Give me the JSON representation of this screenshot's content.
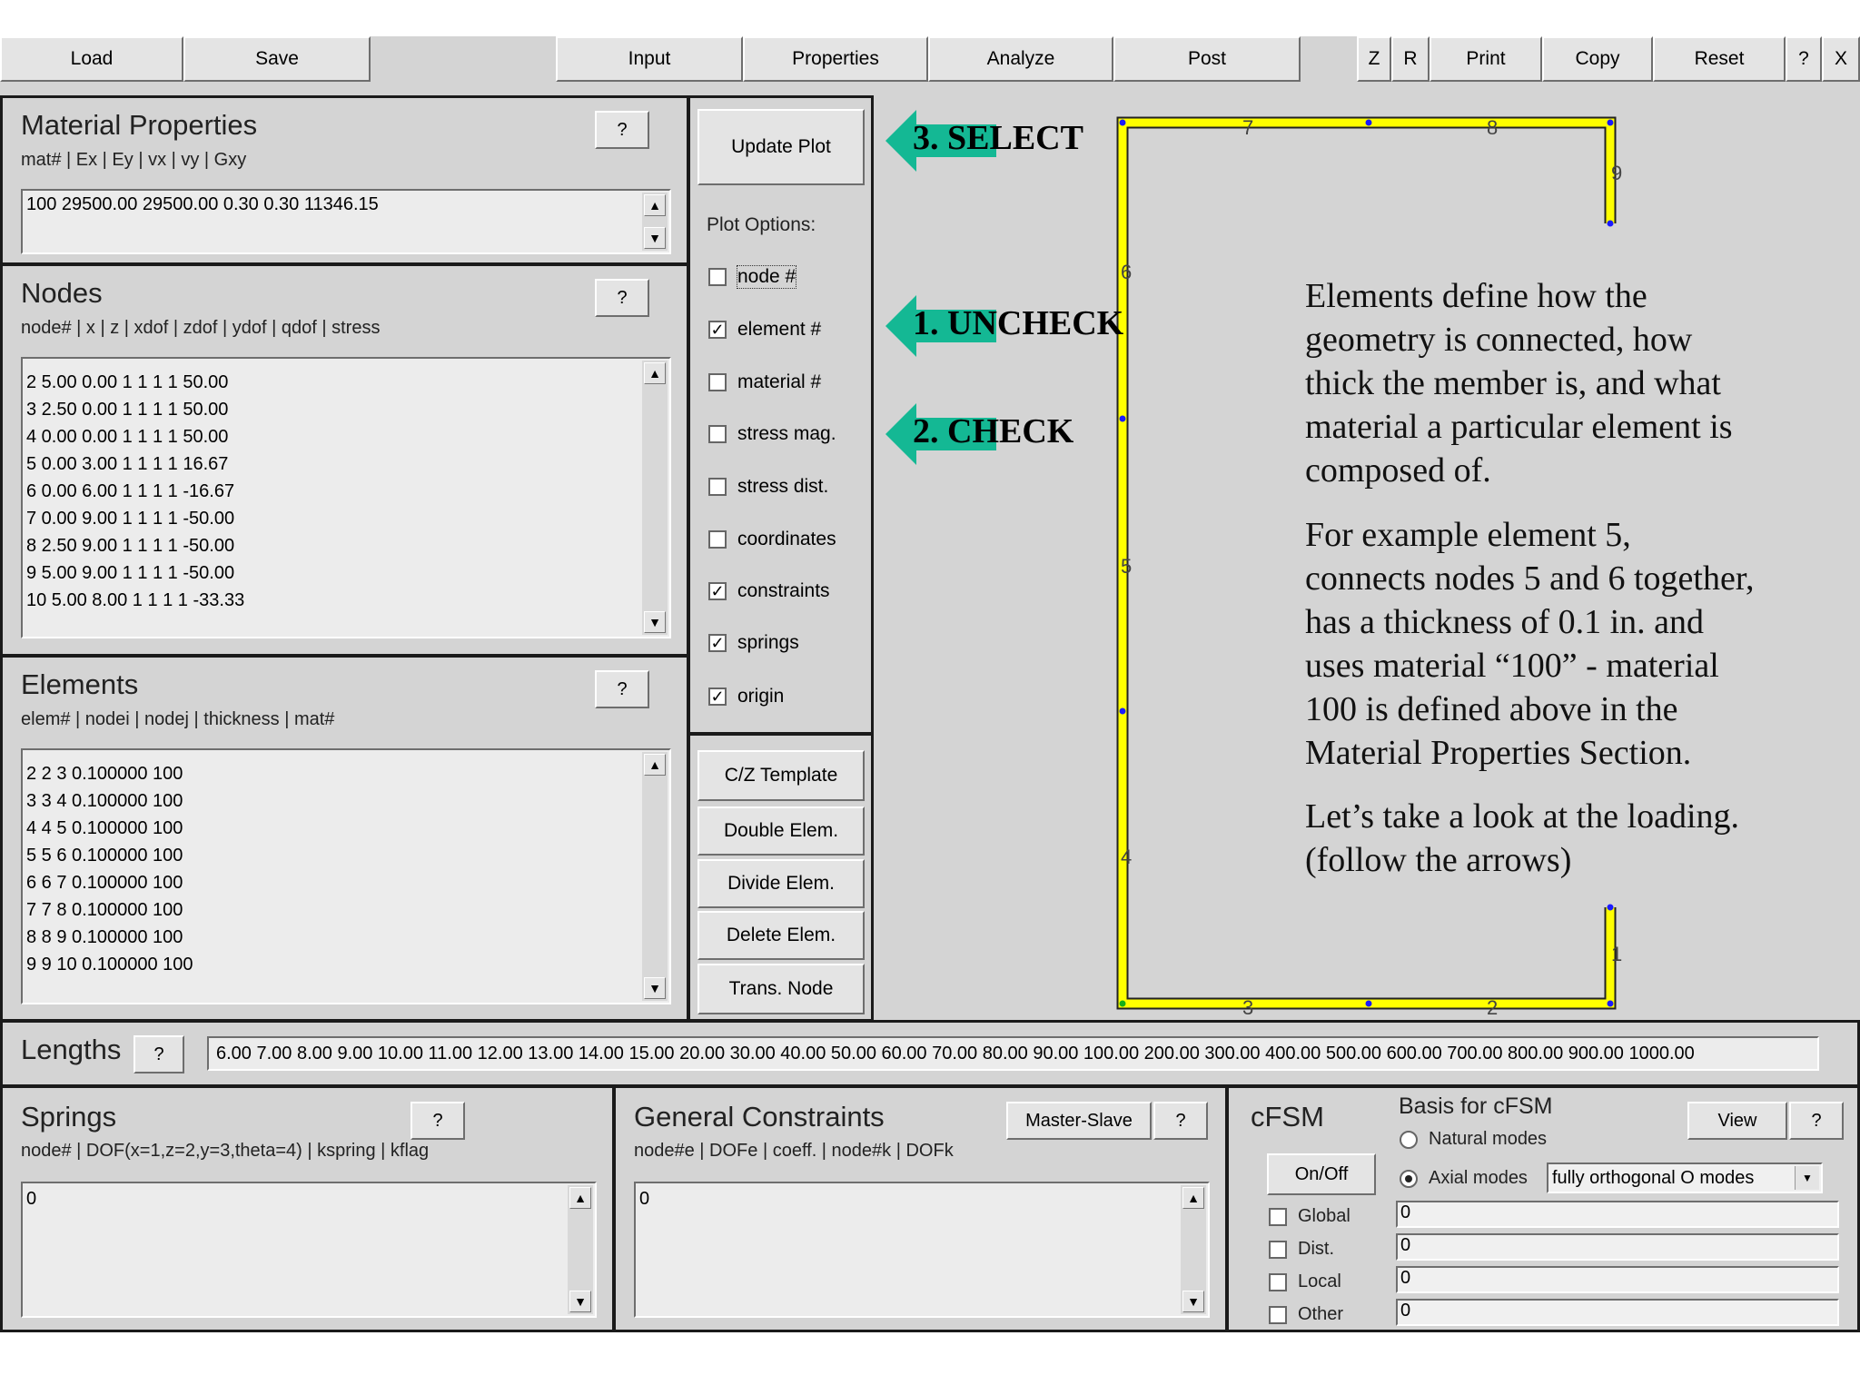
{
  "toolbar": {
    "load": "Load",
    "save": "Save",
    "input": "Input",
    "properties": "Properties",
    "analyze": "Analyze",
    "post": "Post",
    "z": "Z",
    "r": "R",
    "print": "Print",
    "copy": "Copy",
    "reset": "Reset",
    "help": "?",
    "close": "X"
  },
  "material": {
    "title": "Material Properties",
    "header": "mat# | Ex | Ey | vx | vy | Gxy",
    "help": "?",
    "rows": [
      "100 29500.00 29500.00 0.30 0.30 11346.15"
    ]
  },
  "nodes": {
    "title": "Nodes",
    "header": "node# | x | z | xdof | zdof | ydof | qdof | stress",
    "help": "?",
    "rows": [
      "2 5.00 0.00 1 1 1 1 50.00",
      "3 2.50 0.00 1 1 1 1 50.00",
      "4 0.00 0.00 1 1 1 1 50.00",
      "5 0.00 3.00 1 1 1 1 16.67",
      "6 0.00 6.00 1 1 1 1 -16.67",
      "7 0.00 9.00 1 1 1 1 -50.00",
      "8 2.50 9.00 1 1 1 1 -50.00",
      "9 5.00 9.00 1 1 1 1 -50.00",
      "10 5.00 8.00 1 1 1 1 -33.33"
    ]
  },
  "elements": {
    "title": "Elements",
    "header": "elem# | nodei | nodej | thickness | mat#",
    "help": "?",
    "rows": [
      "2 2 3 0.100000 100",
      "3 3 4 0.100000 100",
      "4 4 5 0.100000 100",
      "5 5 6 0.100000 100",
      "6 6 7 0.100000 100",
      "7 7 8 0.100000 100",
      "8 8 9 0.100000 100",
      "9 9 10 0.100000 100"
    ]
  },
  "plot": {
    "update": "Update Plot",
    "options_label": "Plot Options:",
    "options": [
      {
        "label": "node #",
        "checked": false
      },
      {
        "label": "element #",
        "checked": true
      },
      {
        "label": "material #",
        "checked": false
      },
      {
        "label": "stress mag.",
        "checked": false
      },
      {
        "label": "stress dist.",
        "checked": false
      },
      {
        "label": "coordinates",
        "checked": false
      },
      {
        "label": "constraints",
        "checked": true
      },
      {
        "label": "springs",
        "checked": true
      },
      {
        "label": "origin",
        "checked": true
      }
    ],
    "tools": [
      "C/Z Template",
      "Double Elem.",
      "Divide Elem.",
      "Delete Elem.",
      "Trans. Node"
    ]
  },
  "callouts": {
    "select": "3. SELECT",
    "uncheck": "1. UNCHECK",
    "check": "2. CHECK"
  },
  "canvas": {
    "element_labels": [
      "7",
      "8",
      "9",
      "6",
      "5",
      "4",
      "1",
      "3",
      "2"
    ]
  },
  "notes": {
    "p1": [
      "Elements define how the",
      "geometry is connected, how",
      "thick the member is, and what",
      "material a particular element is",
      "composed of."
    ],
    "p2": [
      "For example element 5,",
      "connects nodes 5 and 6 together,",
      "has a thickness of 0.1 in. and",
      "uses material “100” - material",
      "100 is defined above in the",
      "Material Properties Section."
    ],
    "p3": [
      "Let’s take a look at the loading.",
      "(follow the arrows)"
    ]
  },
  "lengths": {
    "title": "Lengths",
    "help": "?",
    "value": "6.00 7.00 8.00 9.00 10.00 11.00 12.00 13.00 14.00 15.00 20.00 30.00 40.00 50.00 60.00 70.00 80.00 90.00 100.00 200.00 300.00 400.00 500.00 600.00 700.00 800.00 900.00 1000.00"
  },
  "springs": {
    "title": "Springs",
    "help": "?",
    "header": "node# | DOF(x=1,z=2,y=3,theta=4) | kspring | kflag",
    "value": "0"
  },
  "constraints": {
    "title": "General Constraints",
    "master_slave": "Master-Slave",
    "help": "?",
    "header": "node#e | DOFe | coeff. | node#k | DOFk",
    "value": "0"
  },
  "cfsm": {
    "title": "cFSM",
    "onoff": "On/Off",
    "basis": "Basis for cFSM",
    "view": "View",
    "help": "?",
    "natural": "Natural modes",
    "axial": "Axial modes",
    "axial_selected": true,
    "dropdown": "fully orthogonal O modes",
    "checks": [
      "Global",
      "Dist.",
      "Local",
      "Other"
    ],
    "values": [
      "0",
      "0",
      "0",
      "0"
    ]
  }
}
